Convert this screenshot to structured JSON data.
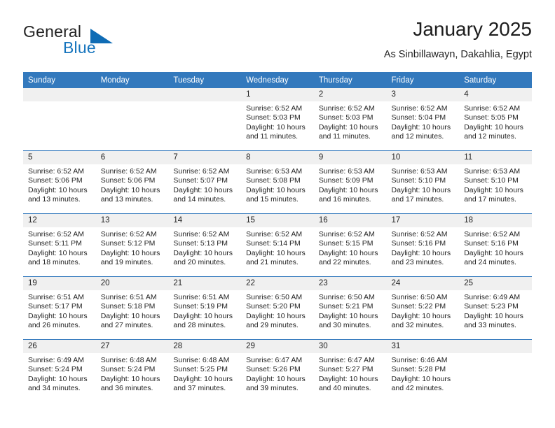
{
  "brand": {
    "name_part1": "General",
    "name_part2": "Blue",
    "triangle_color": "#0f6cb5",
    "blue_text_color": "#1574bd"
  },
  "header": {
    "title": "January 2025",
    "subtitle": "As Sinbillawayn, Dakahlia, Egypt"
  },
  "theme": {
    "header_blue": "#3379bd",
    "daynum_strip": "#f0f0f0",
    "text": "#232323"
  },
  "weekdays": [
    "Sunday",
    "Monday",
    "Tuesday",
    "Wednesday",
    "Thursday",
    "Friday",
    "Saturday"
  ],
  "weeks": [
    [
      {
        "day": "",
        "sunrise": "",
        "sunset": "",
        "daylight1": "",
        "daylight2": ""
      },
      {
        "day": "",
        "sunrise": "",
        "sunset": "",
        "daylight1": "",
        "daylight2": ""
      },
      {
        "day": "",
        "sunrise": "",
        "sunset": "",
        "daylight1": "",
        "daylight2": ""
      },
      {
        "day": "1",
        "sunrise": "Sunrise: 6:52 AM",
        "sunset": "Sunset: 5:03 PM",
        "daylight1": "Daylight: 10 hours",
        "daylight2": "and 11 minutes."
      },
      {
        "day": "2",
        "sunrise": "Sunrise: 6:52 AM",
        "sunset": "Sunset: 5:03 PM",
        "daylight1": "Daylight: 10 hours",
        "daylight2": "and 11 minutes."
      },
      {
        "day": "3",
        "sunrise": "Sunrise: 6:52 AM",
        "sunset": "Sunset: 5:04 PM",
        "daylight1": "Daylight: 10 hours",
        "daylight2": "and 12 minutes."
      },
      {
        "day": "4",
        "sunrise": "Sunrise: 6:52 AM",
        "sunset": "Sunset: 5:05 PM",
        "daylight1": "Daylight: 10 hours",
        "daylight2": "and 12 minutes."
      }
    ],
    [
      {
        "day": "5",
        "sunrise": "Sunrise: 6:52 AM",
        "sunset": "Sunset: 5:06 PM",
        "daylight1": "Daylight: 10 hours",
        "daylight2": "and 13 minutes."
      },
      {
        "day": "6",
        "sunrise": "Sunrise: 6:52 AM",
        "sunset": "Sunset: 5:06 PM",
        "daylight1": "Daylight: 10 hours",
        "daylight2": "and 13 minutes."
      },
      {
        "day": "7",
        "sunrise": "Sunrise: 6:52 AM",
        "sunset": "Sunset: 5:07 PM",
        "daylight1": "Daylight: 10 hours",
        "daylight2": "and 14 minutes."
      },
      {
        "day": "8",
        "sunrise": "Sunrise: 6:53 AM",
        "sunset": "Sunset: 5:08 PM",
        "daylight1": "Daylight: 10 hours",
        "daylight2": "and 15 minutes."
      },
      {
        "day": "9",
        "sunrise": "Sunrise: 6:53 AM",
        "sunset": "Sunset: 5:09 PM",
        "daylight1": "Daylight: 10 hours",
        "daylight2": "and 16 minutes."
      },
      {
        "day": "10",
        "sunrise": "Sunrise: 6:53 AM",
        "sunset": "Sunset: 5:10 PM",
        "daylight1": "Daylight: 10 hours",
        "daylight2": "and 17 minutes."
      },
      {
        "day": "11",
        "sunrise": "Sunrise: 6:53 AM",
        "sunset": "Sunset: 5:10 PM",
        "daylight1": "Daylight: 10 hours",
        "daylight2": "and 17 minutes."
      }
    ],
    [
      {
        "day": "12",
        "sunrise": "Sunrise: 6:52 AM",
        "sunset": "Sunset: 5:11 PM",
        "daylight1": "Daylight: 10 hours",
        "daylight2": "and 18 minutes."
      },
      {
        "day": "13",
        "sunrise": "Sunrise: 6:52 AM",
        "sunset": "Sunset: 5:12 PM",
        "daylight1": "Daylight: 10 hours",
        "daylight2": "and 19 minutes."
      },
      {
        "day": "14",
        "sunrise": "Sunrise: 6:52 AM",
        "sunset": "Sunset: 5:13 PM",
        "daylight1": "Daylight: 10 hours",
        "daylight2": "and 20 minutes."
      },
      {
        "day": "15",
        "sunrise": "Sunrise: 6:52 AM",
        "sunset": "Sunset: 5:14 PM",
        "daylight1": "Daylight: 10 hours",
        "daylight2": "and 21 minutes."
      },
      {
        "day": "16",
        "sunrise": "Sunrise: 6:52 AM",
        "sunset": "Sunset: 5:15 PM",
        "daylight1": "Daylight: 10 hours",
        "daylight2": "and 22 minutes."
      },
      {
        "day": "17",
        "sunrise": "Sunrise: 6:52 AM",
        "sunset": "Sunset: 5:16 PM",
        "daylight1": "Daylight: 10 hours",
        "daylight2": "and 23 minutes."
      },
      {
        "day": "18",
        "sunrise": "Sunrise: 6:52 AM",
        "sunset": "Sunset: 5:16 PM",
        "daylight1": "Daylight: 10 hours",
        "daylight2": "and 24 minutes."
      }
    ],
    [
      {
        "day": "19",
        "sunrise": "Sunrise: 6:51 AM",
        "sunset": "Sunset: 5:17 PM",
        "daylight1": "Daylight: 10 hours",
        "daylight2": "and 26 minutes."
      },
      {
        "day": "20",
        "sunrise": "Sunrise: 6:51 AM",
        "sunset": "Sunset: 5:18 PM",
        "daylight1": "Daylight: 10 hours",
        "daylight2": "and 27 minutes."
      },
      {
        "day": "21",
        "sunrise": "Sunrise: 6:51 AM",
        "sunset": "Sunset: 5:19 PM",
        "daylight1": "Daylight: 10 hours",
        "daylight2": "and 28 minutes."
      },
      {
        "day": "22",
        "sunrise": "Sunrise: 6:50 AM",
        "sunset": "Sunset: 5:20 PM",
        "daylight1": "Daylight: 10 hours",
        "daylight2": "and 29 minutes."
      },
      {
        "day": "23",
        "sunrise": "Sunrise: 6:50 AM",
        "sunset": "Sunset: 5:21 PM",
        "daylight1": "Daylight: 10 hours",
        "daylight2": "and 30 minutes."
      },
      {
        "day": "24",
        "sunrise": "Sunrise: 6:50 AM",
        "sunset": "Sunset: 5:22 PM",
        "daylight1": "Daylight: 10 hours",
        "daylight2": "and 32 minutes."
      },
      {
        "day": "25",
        "sunrise": "Sunrise: 6:49 AM",
        "sunset": "Sunset: 5:23 PM",
        "daylight1": "Daylight: 10 hours",
        "daylight2": "and 33 minutes."
      }
    ],
    [
      {
        "day": "26",
        "sunrise": "Sunrise: 6:49 AM",
        "sunset": "Sunset: 5:24 PM",
        "daylight1": "Daylight: 10 hours",
        "daylight2": "and 34 minutes."
      },
      {
        "day": "27",
        "sunrise": "Sunrise: 6:48 AM",
        "sunset": "Sunset: 5:24 PM",
        "daylight1": "Daylight: 10 hours",
        "daylight2": "and 36 minutes."
      },
      {
        "day": "28",
        "sunrise": "Sunrise: 6:48 AM",
        "sunset": "Sunset: 5:25 PM",
        "daylight1": "Daylight: 10 hours",
        "daylight2": "and 37 minutes."
      },
      {
        "day": "29",
        "sunrise": "Sunrise: 6:47 AM",
        "sunset": "Sunset: 5:26 PM",
        "daylight1": "Daylight: 10 hours",
        "daylight2": "and 39 minutes."
      },
      {
        "day": "30",
        "sunrise": "Sunrise: 6:47 AM",
        "sunset": "Sunset: 5:27 PM",
        "daylight1": "Daylight: 10 hours",
        "daylight2": "and 40 minutes."
      },
      {
        "day": "31",
        "sunrise": "Sunrise: 6:46 AM",
        "sunset": "Sunset: 5:28 PM",
        "daylight1": "Daylight: 10 hours",
        "daylight2": "and 42 minutes."
      },
      {
        "day": "",
        "sunrise": "",
        "sunset": "",
        "daylight1": "",
        "daylight2": ""
      }
    ]
  ]
}
